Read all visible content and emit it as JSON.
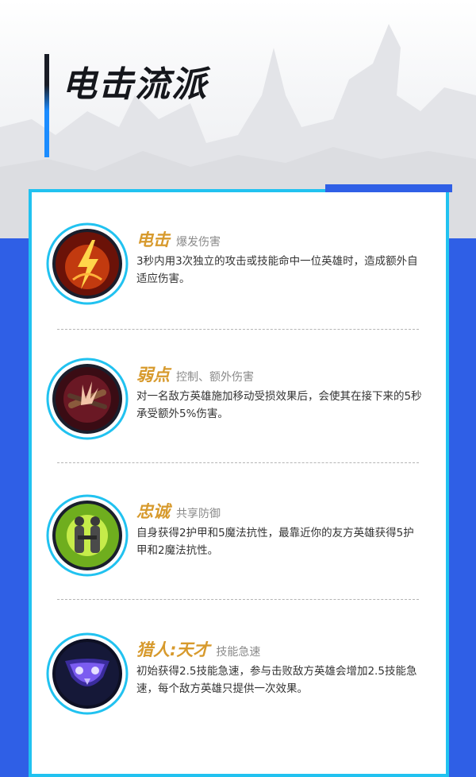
{
  "title": "电击流派",
  "colors": {
    "accent_blue": "#2f5fe6",
    "frame_cyan": "#21c2f0",
    "rune_name_gold": "#d79a2d"
  },
  "runes": [
    {
      "name": "电击",
      "tag": "爆发伤害",
      "description": "3秒内用3次独立的攻击或技能命中一位英雄时，造成额外自适应伤害。",
      "icon": "electrocute-icon"
    },
    {
      "name": "弱点",
      "tag": "控制、额外伤害",
      "description": "对一名敌方英雄施加移动受损效果后，会使其在接下来的5秒承受额外5%伤害。",
      "icon": "weakness-icon"
    },
    {
      "name": "忠诚",
      "tag": "共享防御",
      "description": "自身获得2护甲和5魔法抗性，最靠近你的友方英雄获得5护甲和2魔法抗性。",
      "icon": "loyalty-icon"
    },
    {
      "name": "猎人:天才",
      "tag": "技能急速",
      "description": "初始获得2.5技能急速，参与击败敌方英雄会增加2.5技能急速，每个敌方英雄只提供一次效果。",
      "icon": "hunter-genius-icon"
    }
  ]
}
